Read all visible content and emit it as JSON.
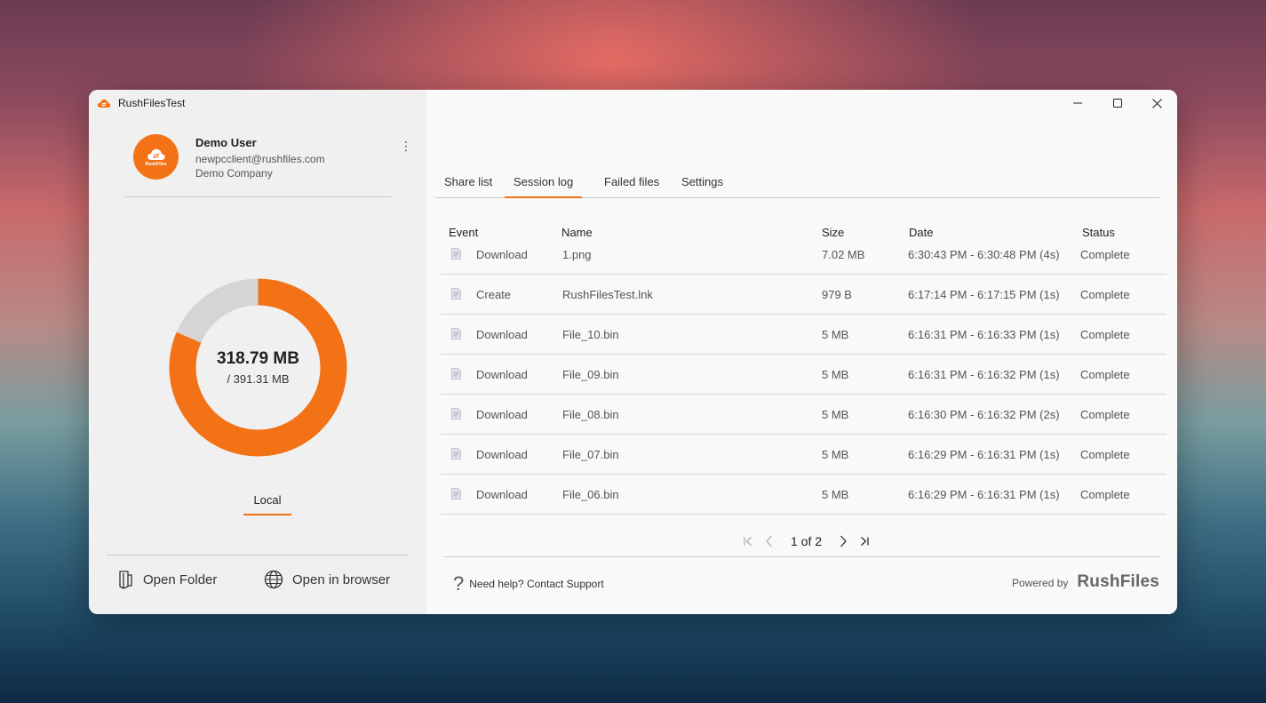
{
  "app": {
    "title": "RushFilesTest"
  },
  "user": {
    "name": "Demo User",
    "email": "newpcclient@rushfiles.com",
    "company": "Demo Company",
    "avatar_text": "RushFiles"
  },
  "storage": {
    "used": "318.79 MB",
    "total": "/ 391.31 MB",
    "used_fraction": 0.8147,
    "colors": {
      "used": "#f47216",
      "free": "#d5d5d5"
    }
  },
  "left_tab": {
    "label": "Local"
  },
  "footer_actions": {
    "open_folder": "Open Folder",
    "open_browser": "Open in browser"
  },
  "tabs": [
    "Share list",
    "Session log",
    "Failed files",
    "Settings"
  ],
  "active_tab": "Session log",
  "table": {
    "headers": {
      "event": "Event",
      "name": "Name",
      "size": "Size",
      "date": "Date",
      "status": "Status"
    },
    "rows": [
      {
        "event": "Download",
        "name": "1.png",
        "size": "7.02 MB",
        "date": "6:30:43 PM - 6:30:48 PM (4s)",
        "status": "Complete"
      },
      {
        "event": "Create",
        "name": "RushFilesTest.lnk",
        "size": "979 B",
        "date": "6:17:14 PM - 6:17:15 PM (1s)",
        "status": "Complete"
      },
      {
        "event": "Download",
        "name": "File_10.bin",
        "size": "5 MB",
        "date": "6:16:31 PM - 6:16:33 PM (1s)",
        "status": "Complete"
      },
      {
        "event": "Download",
        "name": "File_09.bin",
        "size": "5 MB",
        "date": "6:16:31 PM - 6:16:32 PM (1s)",
        "status": "Complete"
      },
      {
        "event": "Download",
        "name": "File_08.bin",
        "size": "5 MB",
        "date": "6:16:30 PM - 6:16:32 PM (2s)",
        "status": "Complete"
      },
      {
        "event": "Download",
        "name": "File_07.bin",
        "size": "5 MB",
        "date": "6:16:29 PM - 6:16:31 PM (1s)",
        "status": "Complete"
      },
      {
        "event": "Download",
        "name": "File_06.bin",
        "size": "5 MB",
        "date": "6:16:29 PM - 6:16:31 PM (1s)",
        "status": "Complete"
      }
    ]
  },
  "pagination": {
    "text": "1 of 2",
    "current": 1,
    "total": 2
  },
  "help": {
    "text": "Need help? Contact Support"
  },
  "powered": {
    "label": "Powered by",
    "brand": "RushFiles"
  },
  "icons": {
    "app_logo": "rushfiles-cloud-icon",
    "menu": "kebab-menu-icon",
    "open_folder": "folder-icon",
    "open_browser": "globe-icon",
    "row": "document-icon",
    "help": "question-mark-icon",
    "window": [
      "minimize-icon",
      "maximize-icon",
      "close-icon"
    ],
    "pager": [
      "first-page-icon",
      "prev-page-icon",
      "next-page-icon",
      "last-page-icon"
    ]
  }
}
